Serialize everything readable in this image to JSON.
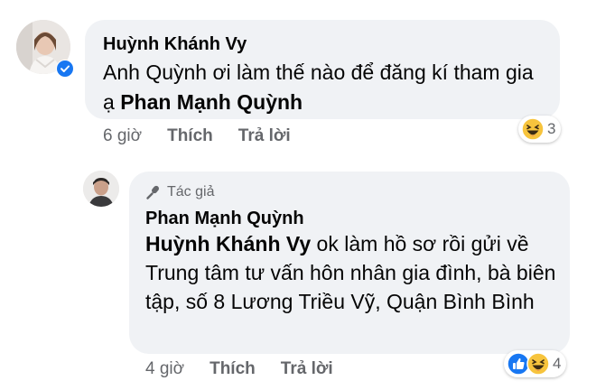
{
  "comment1": {
    "author": "Huỳnh Khánh Vy",
    "text_prefix": "Anh Quỳnh ơi làm thế nào để đăng kí tham gia ạ ",
    "mention": "Phan Mạnh Quỳnh",
    "time": "6 giờ",
    "like_label": "Thích",
    "reply_label": "Trả lời",
    "reaction_count": "3",
    "reaction_icons": [
      "haha-icon"
    ]
  },
  "reply1": {
    "author_badge": "Tác giả",
    "author": "Phan Mạnh Quỳnh",
    "mention": "Huỳnh Khánh Vy",
    "text": " ok làm hồ sơ rồi gửi về Trung tâm tư vấn hôn nhân gia đình, bà biên tập, số 8 Lương Triều Vỹ, Quận Bình Bình",
    "time": "4 giờ",
    "like_label": "Thích",
    "reply_label": "Trả lời",
    "reaction_count": "4",
    "reaction_icons": [
      "like-icon",
      "haha-icon"
    ]
  },
  "colors": {
    "bubble": "#f0f2f5",
    "secondary_text": "#65676b",
    "like_blue": "#1877f2",
    "haha_yellow": "#f7c43d"
  }
}
